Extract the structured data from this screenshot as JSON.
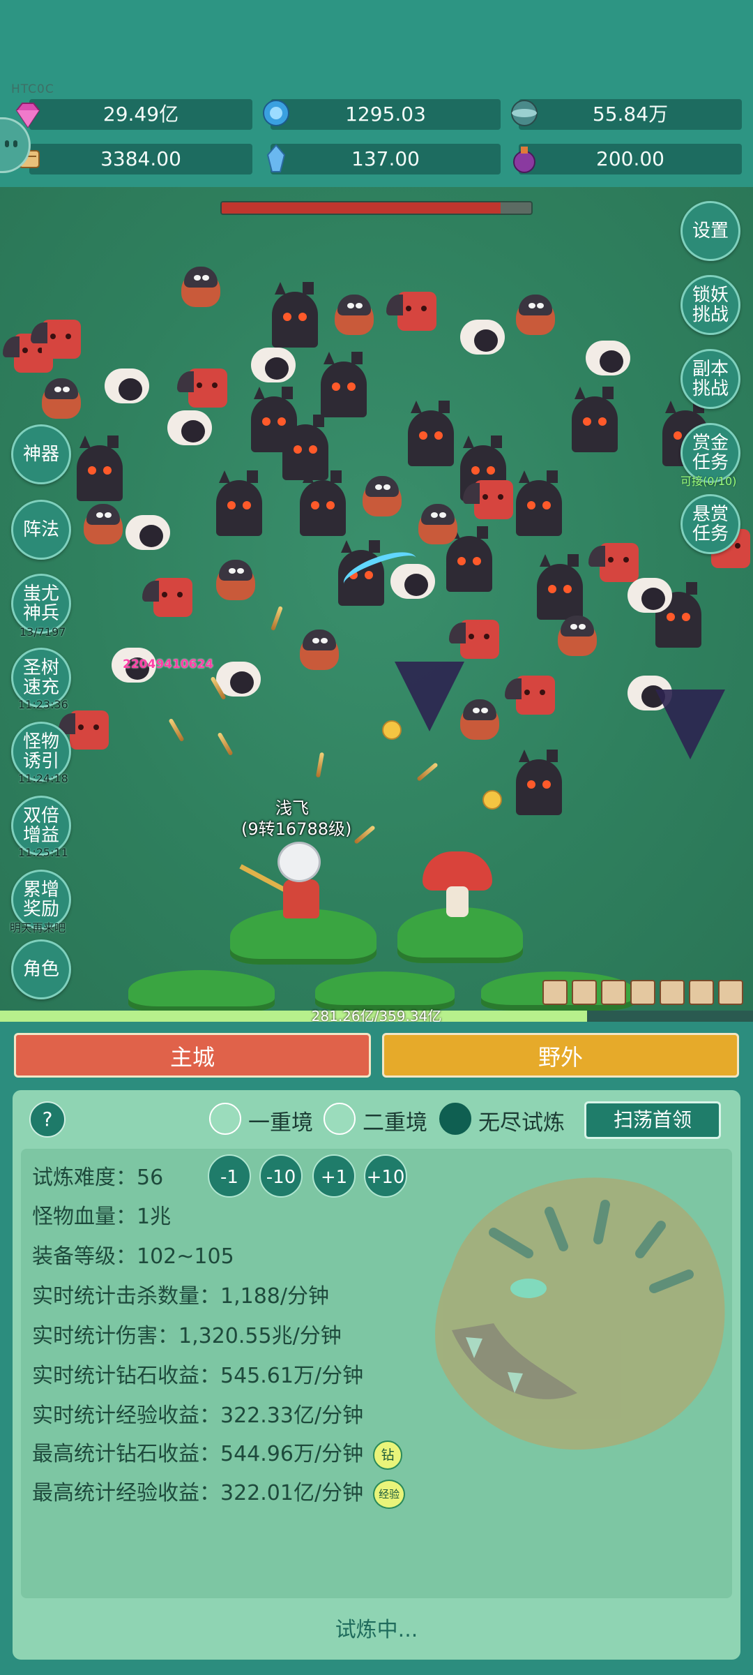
{
  "header": {
    "corner_label": "HTC0C",
    "resources": [
      {
        "icon": "diamond-icon",
        "value": "29.49亿",
        "color": "#d94bb0"
      },
      {
        "icon": "blue-crystal-icon",
        "value": "1295.03",
        "color": "#3aa0e0"
      },
      {
        "icon": "orb-icon",
        "value": "55.84万",
        "color": "#4a8a8a"
      },
      {
        "icon": "scroll-icon",
        "value": "3384.00",
        "color": "#d8a050"
      },
      {
        "icon": "ice-crystal-icon",
        "value": "137.00",
        "color": "#6ab8f0"
      },
      {
        "icon": "potion-icon",
        "value": "200.00",
        "color": "#8a3aa0"
      }
    ]
  },
  "battle": {
    "boss_hp_fraction": 0.9,
    "damage_number": "22049410624",
    "player": {
      "name": "浅飞",
      "level": "(9转16788级)"
    },
    "left_buttons": [
      {
        "label": "神器"
      },
      {
        "label": "阵法"
      },
      {
        "label": "蚩尤神兵",
        "sub": "13/7197"
      },
      {
        "label": "圣树速充",
        "sub": "11:23:36"
      },
      {
        "label": "怪物诱引",
        "sub": "11:24:18"
      },
      {
        "label": "双倍增益",
        "sub": "11:25:11"
      },
      {
        "label": "累增奖励",
        "sub": "明天再来吧"
      },
      {
        "label": "角色"
      }
    ],
    "right_buttons": [
      {
        "label": "设置"
      },
      {
        "label": "锁妖挑战"
      },
      {
        "label": "副本挑战"
      },
      {
        "label": "赏金任务",
        "sub": "可接(0/10)"
      },
      {
        "label": "悬赏任务"
      }
    ],
    "exp_text": "281.26亿/359.34亿",
    "exp_fraction": 0.78
  },
  "tabs": {
    "main_city": "主城",
    "wild": "野外"
  },
  "trial": {
    "help": "?",
    "modes": [
      {
        "label": "一重境",
        "selected": false
      },
      {
        "label": "二重境",
        "selected": false
      },
      {
        "label": "无尽试炼",
        "selected": true
      }
    ],
    "sweep_button": "扫荡首领",
    "difficulty_label": "试炼难度：",
    "difficulty_value": "56",
    "difficulty_buttons": [
      "-1",
      "-10",
      "+1",
      "+10"
    ],
    "stats": [
      {
        "label": "怪物血量：1兆"
      },
      {
        "label": "装备等级：102~105"
      },
      {
        "label": "实时统计击杀数量：1,188/分钟"
      },
      {
        "label": "实时统计伤害：1,320.55兆/分钟"
      },
      {
        "label": "实时统计钻石收益：545.61万/分钟"
      },
      {
        "label": "实时统计经验收益：322.33亿/分钟"
      },
      {
        "label": "最高统计钻石收益：544.96万/分钟",
        "tag": "钻"
      },
      {
        "label": "最高统计经验收益：322.01亿/分钟",
        "tag": "经验"
      }
    ],
    "status": "试炼中..."
  }
}
